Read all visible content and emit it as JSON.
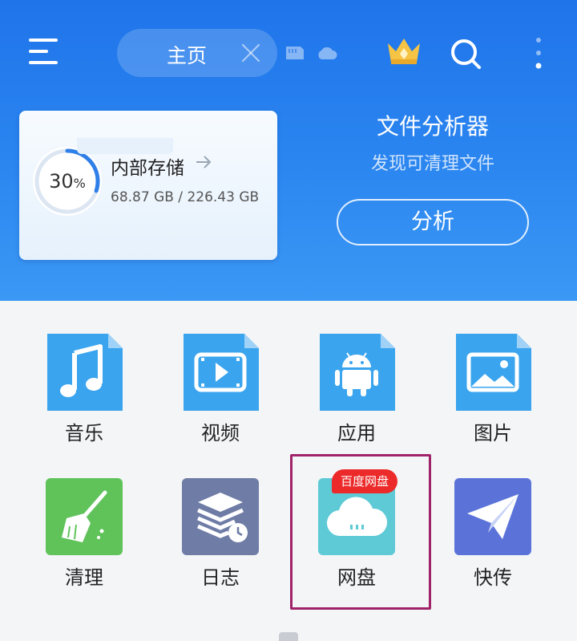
{
  "header": {
    "tab_label": "主页"
  },
  "storage": {
    "percent_value": "30",
    "percent_sign": "%",
    "usage_fraction": 0.3,
    "title": "内部存储",
    "size_text": "68.87 GB / 226.43 GB"
  },
  "analyzer": {
    "title": "文件分析器",
    "subtitle": "发现可清理文件",
    "button_label": "分析"
  },
  "grid": {
    "items": [
      {
        "label": "音乐",
        "icon": "music-icon",
        "color": "#3aa4ee"
      },
      {
        "label": "视频",
        "icon": "video-icon",
        "color": "#3aa4ee"
      },
      {
        "label": "应用",
        "icon": "android-icon",
        "color": "#3aa4ee"
      },
      {
        "label": "图片",
        "icon": "image-icon",
        "color": "#3aa4ee"
      },
      {
        "label": "清理",
        "icon": "broom-icon",
        "color": "#5fc35a"
      },
      {
        "label": "日志",
        "icon": "log-icon",
        "color": "#6e7ca6"
      },
      {
        "label": "网盘",
        "icon": "cloud-drive-icon",
        "color": "#5ecad6",
        "badge": "百度网盘"
      },
      {
        "label": "快传",
        "icon": "paper-plane-icon",
        "color": "#5b73d9"
      }
    ]
  },
  "colors": {
    "header_top": "#1f74ea",
    "header_bottom": "#3b98f4",
    "highlight": "#a0236a",
    "badge": "#ec2a2a"
  }
}
